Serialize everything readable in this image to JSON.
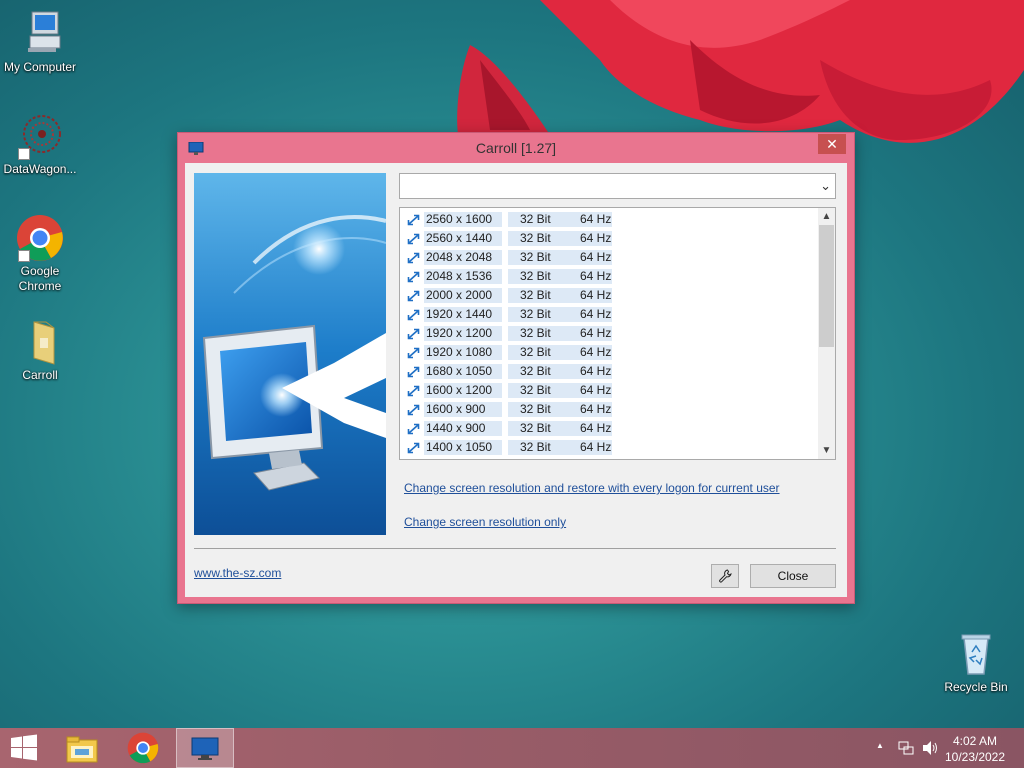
{
  "desktop": {
    "icons": [
      {
        "label": "My Computer"
      },
      {
        "label": "DataWagon..."
      },
      {
        "label": "Google Chrome"
      },
      {
        "label": "Carroll"
      },
      {
        "label": "Recycle Bin"
      }
    ]
  },
  "window": {
    "title": "Carroll [1.27]",
    "close_glyph": "✕",
    "combo": {
      "value": "",
      "chevron": "⌄"
    },
    "resolutions": [
      {
        "res": "2560 x 1600",
        "bit": "32 Bit",
        "hz": "64 Hz"
      },
      {
        "res": "2560 x 1440",
        "bit": "32 Bit",
        "hz": "64 Hz"
      },
      {
        "res": "2048 x 2048",
        "bit": "32 Bit",
        "hz": "64 Hz"
      },
      {
        "res": "2048 x 1536",
        "bit": "32 Bit",
        "hz": "64 Hz"
      },
      {
        "res": "2000 x 2000",
        "bit": "32 Bit",
        "hz": "64 Hz"
      },
      {
        "res": "1920 x 1440",
        "bit": "32 Bit",
        "hz": "64 Hz"
      },
      {
        "res": "1920 x 1200",
        "bit": "32 Bit",
        "hz": "64 Hz"
      },
      {
        "res": "1920 x 1080",
        "bit": "32 Bit",
        "hz": "64 Hz"
      },
      {
        "res": "1680 x 1050",
        "bit": "32 Bit",
        "hz": "64 Hz"
      },
      {
        "res": "1600 x 1200",
        "bit": "32 Bit",
        "hz": "64 Hz"
      },
      {
        "res": "1600 x 900",
        "bit": "32 Bit",
        "hz": "64 Hz"
      },
      {
        "res": "1440 x 900",
        "bit": "32 Bit",
        "hz": "64 Hz"
      },
      {
        "res": "1400 x 1050",
        "bit": "32 Bit",
        "hz": "64 Hz"
      }
    ],
    "link_restore": "Change screen resolution and restore with every logon for current user",
    "link_only": "Change screen resolution only",
    "website": "www.the-sz.com",
    "settings_icon": "wrench-icon",
    "close_label": "Close"
  },
  "taskbar": {
    "time": "4:02 AM",
    "date": "10/23/2022",
    "tray_arrow": "▲"
  },
  "colors": {
    "window_frame": "#e9758f",
    "link": "#1f4f9a",
    "row_highlight": "#dde9f6"
  }
}
